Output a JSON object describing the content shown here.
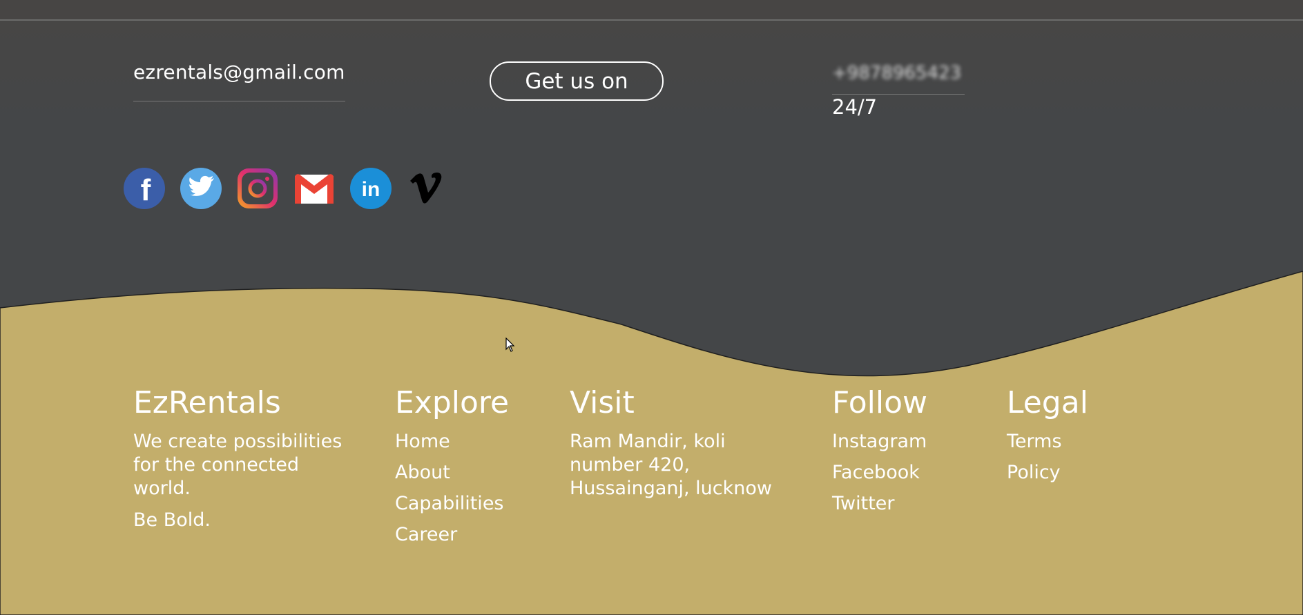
{
  "contact": {
    "email": "ezrentals@gmail.com",
    "get_us_on_label": "Get us on",
    "phone": "+9878965423",
    "hours": "24/7"
  },
  "socials": [
    {
      "name": "facebook",
      "glyph": "f",
      "color": "#3b5ea9"
    },
    {
      "name": "twitter",
      "color": "#5aa9e6"
    },
    {
      "name": "instagram",
      "color": "#c13584"
    },
    {
      "name": "gmail",
      "color": "#ea4335"
    },
    {
      "name": "linkedin",
      "glyph": "in",
      "color": "#1b8fd8"
    },
    {
      "name": "vimeo",
      "glyph": "v",
      "color": "#000000"
    }
  ],
  "colors": {
    "dark_bg": "#444648",
    "gold_bg": "#c3ae6b"
  },
  "footer": {
    "brand": {
      "title": "EzRentals",
      "tagline_lines": [
        "We create possibilities",
        "for the connected",
        "world."
      ],
      "motto": "Be Bold."
    },
    "explore": {
      "title": "Explore",
      "links": [
        "Home",
        "About",
        "Capabilities",
        "Career"
      ]
    },
    "visit": {
      "title": "Visit",
      "address_lines": [
        "Ram Mandir, koli",
        "number 420,",
        "Hussainganj, lucknow"
      ]
    },
    "follow": {
      "title": "Follow",
      "links": [
        "Instagram",
        "Facebook",
        "Twitter"
      ]
    },
    "legal": {
      "title": "Legal",
      "links": [
        "Terms",
        "Policy"
      ]
    }
  }
}
